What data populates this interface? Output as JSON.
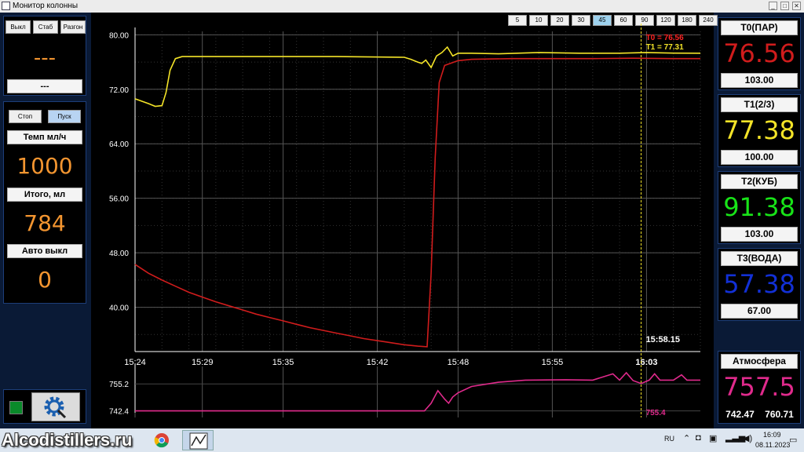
{
  "window": {
    "title": "Монитор колонны",
    "minimize": "_",
    "maximize": "□",
    "close": "✕"
  },
  "left": {
    "modes": [
      "Выкл",
      "Стаб",
      "Разгон"
    ],
    "status_value": "---",
    "status_sub": "---",
    "controls": [
      "Стоп",
      "Пуск"
    ],
    "temp_label": "Темп мл/ч",
    "temp_value": "1000",
    "total_label": "Итого, мл",
    "total_value": "784",
    "auto_label": "Авто выкл",
    "auto_value": "0",
    "indicator_color": "#0a8a2a"
  },
  "ranges": [
    "5",
    "10",
    "20",
    "30",
    "45",
    "60",
    "90",
    "120",
    "180",
    "240"
  ],
  "active_range": "45",
  "sensors": [
    {
      "title": "T0(ПАР)",
      "value": "76.56",
      "setpoint": "103.00",
      "color": "#d01c1c"
    },
    {
      "title": "T1(2/3)",
      "value": "77.38",
      "setpoint": "100.00",
      "color": "#f4e428"
    },
    {
      "title": "T2(КУБ)",
      "value": "91.38",
      "setpoint": "103.00",
      "color": "#18e418"
    },
    {
      "title": "T3(ВОДА)",
      "value": "57.38",
      "setpoint": "67.00",
      "color": "#1230d6"
    }
  ],
  "atmosphere": {
    "title": "Атмосфера",
    "value": "757.5",
    "min": "742.47",
    "max": "760.71",
    "color": "#e02a8c"
  },
  "chart_data": [
    {
      "type": "line",
      "x_unit": "minutes",
      "x_ticks": [
        "15:24",
        "15:29",
        "15:35",
        "15:42",
        "15:48",
        "15:55",
        "16:03"
      ],
      "y_ticks": [
        "80.00",
        "72.00",
        "64.00",
        "56.00",
        "48.00",
        "40.00"
      ],
      "ylim": [
        33.5,
        80.5
      ],
      "xlim": [
        0,
        42
      ],
      "cursor_time": "15:58.15",
      "cursor_x": 37.6,
      "legend": [
        "T0 = 76.56",
        "T1 = 77.31"
      ],
      "series": [
        {
          "color": "#d01c1c",
          "x": [
            0,
            1,
            2,
            3,
            4,
            5,
            6,
            7,
            8,
            9,
            10,
            11,
            12,
            13,
            14,
            15,
            16,
            17,
            18,
            19,
            20,
            21,
            21.7,
            22,
            22.3,
            22.6,
            23,
            24,
            25,
            28,
            31,
            34,
            37,
            40,
            42
          ],
          "y": [
            46.3,
            45.0,
            44.0,
            43.1,
            42.2,
            41.5,
            40.8,
            40.2,
            39.6,
            39.0,
            38.5,
            38.0,
            37.5,
            37.0,
            36.6,
            36.2,
            35.8,
            35.4,
            35.1,
            34.8,
            34.5,
            34.3,
            34.2,
            45.0,
            62.0,
            73.0,
            75.5,
            76.2,
            76.4,
            76.5,
            76.5,
            76.5,
            76.56,
            76.5,
            76.5
          ]
        },
        {
          "color": "#f4e428",
          "x": [
            0,
            1,
            1.5,
            2,
            2.3,
            2.6,
            3,
            3.5,
            4,
            6,
            10,
            15,
            20,
            20.5,
            21,
            21.3,
            21.6,
            22,
            22.4,
            22.8,
            23.2,
            23.6,
            24,
            25,
            27,
            30,
            33,
            36,
            38,
            40,
            42
          ],
          "y": [
            70.6,
            69.9,
            69.5,
            69.6,
            71.5,
            74.8,
            76.5,
            76.8,
            76.8,
            76.8,
            76.8,
            76.8,
            76.7,
            76.4,
            76.0,
            75.8,
            76.3,
            75.2,
            76.9,
            77.4,
            78.2,
            76.9,
            77.3,
            77.3,
            77.2,
            77.4,
            77.3,
            77.3,
            77.4,
            77.31,
            77.3
          ]
        }
      ]
    },
    {
      "type": "line",
      "y_ticks": [
        "755.2",
        "742.4"
      ],
      "ylim": [
        741.5,
        762
      ],
      "xlim": [
        0,
        42
      ],
      "cursor_label": "755.4",
      "series": [
        {
          "color": "#e02a8c",
          "x": [
            0,
            5,
            10,
            15,
            21.5,
            22,
            22.5,
            23,
            23.3,
            23.6,
            24,
            25,
            27,
            29,
            32,
            34,
            35.5,
            36,
            36.5,
            37,
            37.6,
            38.2,
            38.6,
            39,
            40,
            40.6,
            41,
            42
          ],
          "y": [
            742.4,
            742.4,
            742.4,
            742.4,
            742.4,
            746.0,
            752.0,
            748.0,
            746.0,
            749.0,
            751.0,
            754.0,
            756.0,
            757.0,
            757.2,
            757.0,
            760.0,
            757.0,
            760.5,
            756.8,
            755.4,
            757.0,
            760.0,
            757.0,
            757.0,
            759.5,
            757.0,
            757.0
          ]
        }
      ]
    }
  ],
  "taskbar": {
    "watermark": "Alcodistillers.ru",
    "lang": "RU",
    "time": "16:09",
    "date": "08.11.2023"
  }
}
